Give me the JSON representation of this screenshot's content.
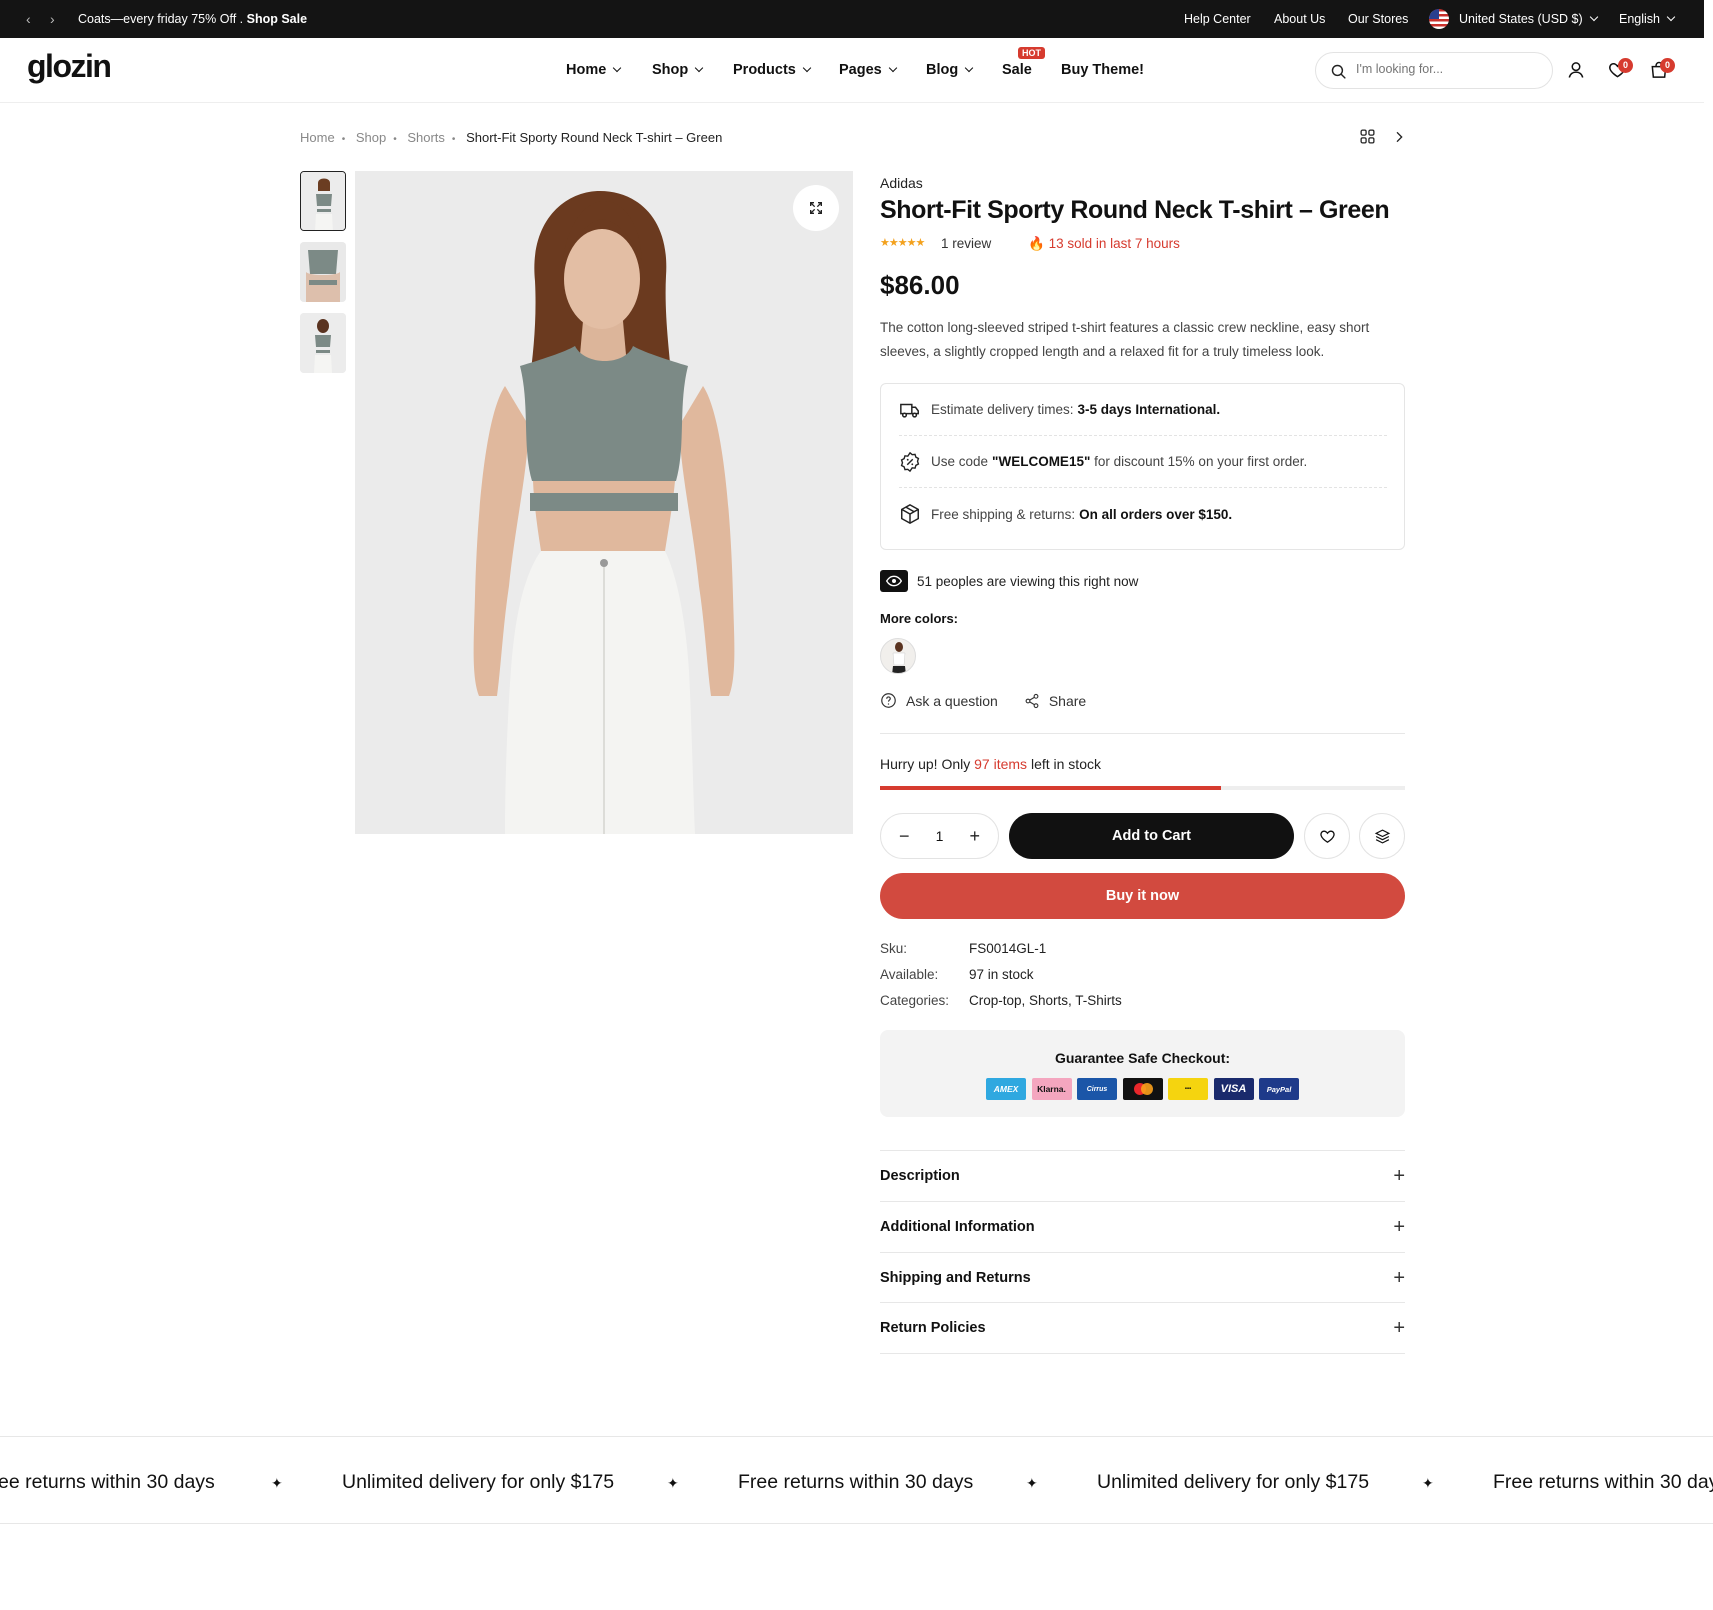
{
  "topbar": {
    "promo_text": "Coats—every friday 75% Off .",
    "promo_link": "Shop Sale",
    "help": "Help Center",
    "about": "About Us",
    "stores": "Our Stores",
    "currency": "United States (USD $)",
    "language": "English"
  },
  "header": {
    "logo": "glozin",
    "nav": [
      "Home",
      "Shop",
      "Products",
      "Pages",
      "Blog",
      "Sale",
      "Buy Theme!"
    ],
    "hot_badge": "HOT",
    "search_placeholder": "I'm looking for...",
    "wishlist_count": "0",
    "cart_count": "0"
  },
  "breadcrumb": [
    "Home",
    "Shop",
    "Shorts",
    "Short-Fit Sporty Round Neck T-shirt – Green"
  ],
  "product": {
    "brand": "Adidas",
    "title": "Short-Fit Sporty Round Neck T-shirt – Green",
    "rating": 5,
    "stars": "★★★★★",
    "reviews": "1 review",
    "sold": "13 sold in last 7 hours",
    "price": "$86.00",
    "description": "The cotton long-sleeved striped t-shirt features a classic crew neckline, easy short sleeves, a slightly cropped length and a relaxed fit for a truly timeless look.",
    "info": [
      {
        "icon": "delivery-truck-icon",
        "text": "Estimate delivery times:",
        "bold": "3-5 days International."
      },
      {
        "icon": "discount-badge-icon",
        "text_pre": "Use code",
        "bold": "\"WELCOME15\"",
        "text_post": "for discount 15% on your first order."
      },
      {
        "icon": "package-box-icon",
        "text": "Free shipping & returns:",
        "bold": "On all orders over $150."
      }
    ],
    "viewing": "51 peoples are viewing this right now",
    "more_colors": "More colors:",
    "ask": "Ask a question",
    "share": "Share",
    "stock": {
      "pre": "Hurry up! Only",
      "count": "97 items",
      "post": "left in stock",
      "level_percent": 65
    },
    "quantity": "1",
    "add_to_cart": "Add to Cart",
    "buy_now": "Buy it now",
    "meta": [
      {
        "label": "Sku:",
        "value": "FS0014GL-1"
      },
      {
        "label": "Available:",
        "value": "97 in stock"
      },
      {
        "label": "Categories:",
        "value": "Crop-top, Shorts, T-Shirts"
      }
    ],
    "guarantee": "Guarantee Safe Checkout:",
    "payments": [
      "AMEX",
      "Klarna.",
      "Cirrus",
      "Mastercard",
      "Maestro",
      "VISA",
      "PayPal"
    ],
    "accordion": [
      "Description",
      "Additional Information",
      "Shipping and Returns",
      "Return Policies"
    ]
  },
  "marquee": [
    "ee returns within 30 days",
    "Unlimited delivery for only $175",
    "Free returns within 30 days",
    "Unlimited delivery for only $175",
    "Free returns within 30 day"
  ],
  "colors": {
    "accent_red": "#d63b2f",
    "buy_now": "#d24a3f",
    "dark": "#111111"
  }
}
